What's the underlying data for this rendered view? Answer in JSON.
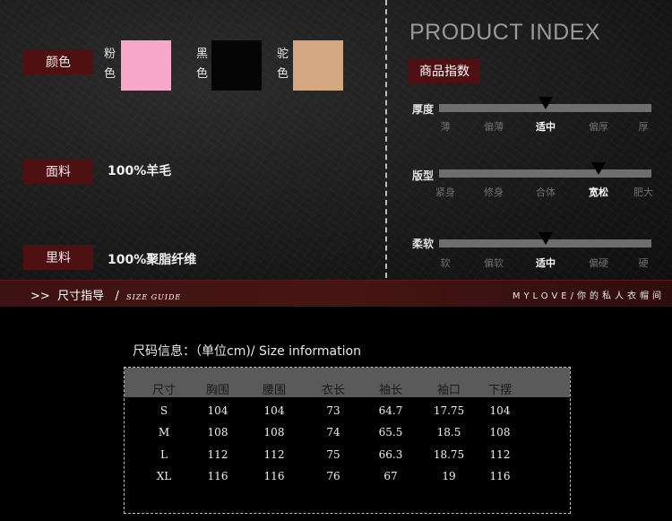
{
  "left": {
    "color_label": "颜色",
    "swatches": [
      {
        "name_top": "粉",
        "name_bottom": "色",
        "color": "#f7a8c9"
      },
      {
        "name_top": "黑",
        "name_bottom": "色",
        "color": "#050505"
      },
      {
        "name_top": "驼",
        "name_bottom": "色",
        "color": "#d3a782"
      }
    ],
    "fabric_label": "面料",
    "fabric_value": "100%羊毛",
    "lining_label": "里料",
    "lining_value": "100%聚脂纤维"
  },
  "product_index": {
    "title": "PRODUCT INDEX",
    "badge": "商品指数",
    "scales": [
      {
        "label": "厚度",
        "ticks": [
          "薄",
          "偏薄",
          "适中",
          "偏厚",
          "厚"
        ],
        "selected": 2
      },
      {
        "label": "版型",
        "ticks": [
          "紧身",
          "修身",
          "合体",
          "宽松",
          "肥大"
        ],
        "selected": 3
      },
      {
        "label": "柔软",
        "ticks": [
          "软",
          "偏软",
          "适中",
          "偏硬",
          "硬"
        ],
        "selected": 2
      }
    ]
  },
  "band": {
    "prefix": ">>",
    "title": "尺寸指导",
    "slash": "/",
    "guide": "SIZE GUIDE",
    "right_text": "MYLOVE/你的私人衣帽间"
  },
  "size_table": {
    "caption": "尺码信息：（单位cm)/ Size information",
    "headers": [
      "尺寸",
      "胸围",
      "腰围",
      "衣长",
      "袖长",
      "袖口",
      "下摆"
    ],
    "rows": [
      [
        "S",
        "104",
        "104",
        "73",
        "64.7",
        "17.75",
        "104"
      ],
      [
        "M",
        "108",
        "108",
        "74",
        "65.5",
        "18.5",
        "108"
      ],
      [
        "L",
        "112",
        "112",
        "75",
        "66.3",
        "18.75",
        "112"
      ],
      [
        "XL",
        "116",
        "116",
        "76",
        "67",
        "19",
        "116"
      ]
    ]
  }
}
